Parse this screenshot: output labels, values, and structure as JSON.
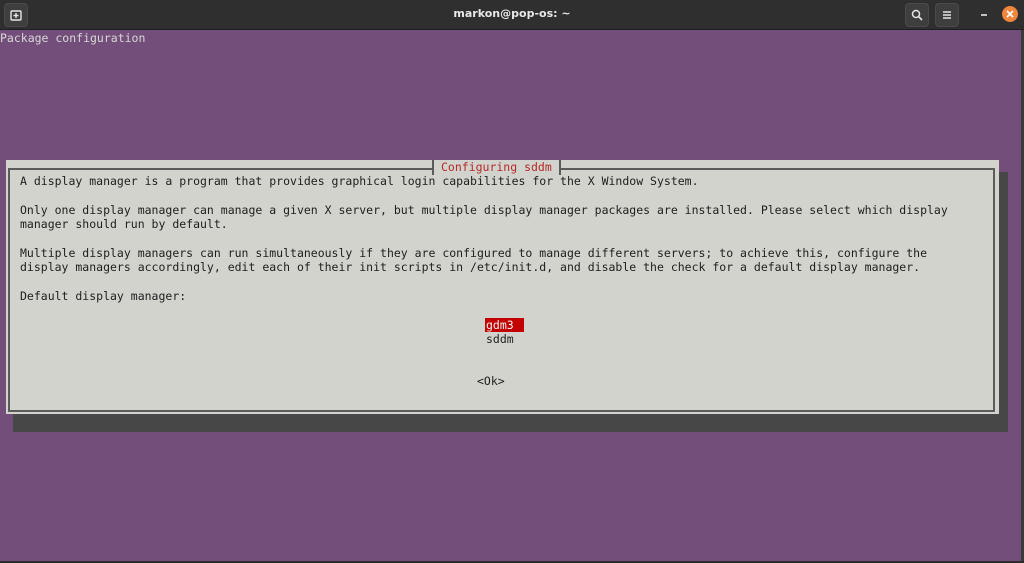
{
  "window": {
    "title": "markon@pop-os: ~",
    "buttons": {
      "new_tab_icon": "new-tab-icon",
      "search_icon": "search-icon",
      "menu_icon": "hamburger-menu-icon",
      "minimize_icon": "minimize-icon",
      "close_icon": "close-icon"
    },
    "colors": {
      "terminal_bg": "#744e7a",
      "dialog_bg": "#d2d3cd",
      "selection": "#c30000",
      "close": "#f0853b"
    }
  },
  "terminal": {
    "header": "Package configuration"
  },
  "dialog": {
    "title": "Configuring sddm",
    "paragraph1": "A display manager is a program that provides graphical login capabilities for the X Window System.",
    "paragraph2_line1": "Only one display manager can manage a given X server, but multiple display manager packages are installed. Please select which display",
    "paragraph2_line2": "manager should run by default.",
    "paragraph3_line1": "Multiple display managers can run simultaneously if they are configured to manage different servers; to achieve this, configure the",
    "paragraph3_line2": "display managers accordingly, edit each of their init scripts in /etc/init.d, and disable the check for a default display manager.",
    "prompt": "Default display manager:",
    "options": [
      {
        "label": "gdm3",
        "selected": true
      },
      {
        "label": "sddm",
        "selected": false
      }
    ],
    "ok_label": "<Ok>"
  }
}
